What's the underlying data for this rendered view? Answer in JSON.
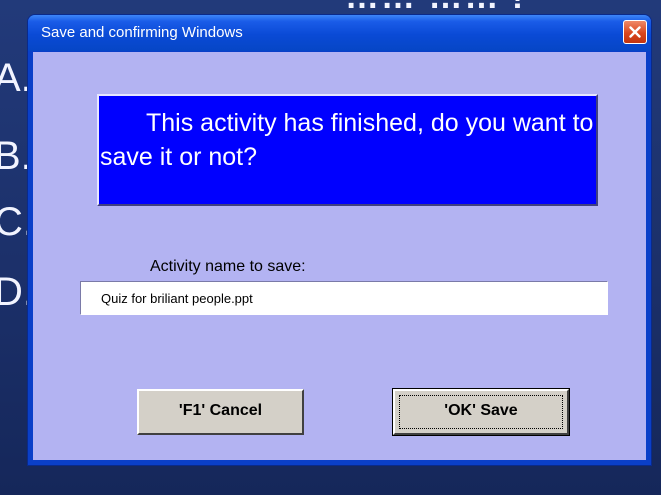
{
  "slide": {
    "title_fragment": "…… …… !",
    "option_letters": [
      "A.",
      "B.",
      "C.",
      "D."
    ]
  },
  "dialog": {
    "title": "Save and confirming Windows",
    "close_icon": "close-icon",
    "message": "This activity has finished, do you want to save it or not?",
    "name_label": "Activity name to save:",
    "name_value": "Quiz for briliant people.ppt",
    "cancel_label": "'F1' Cancel",
    "save_label": "'OK' Save"
  },
  "colors": {
    "titlebar": "#0a4ad6",
    "client_background": "#b3b3f2",
    "message_background": "#0000ff",
    "button_face": "#d4d0c8",
    "close_button": "#d9471e"
  }
}
